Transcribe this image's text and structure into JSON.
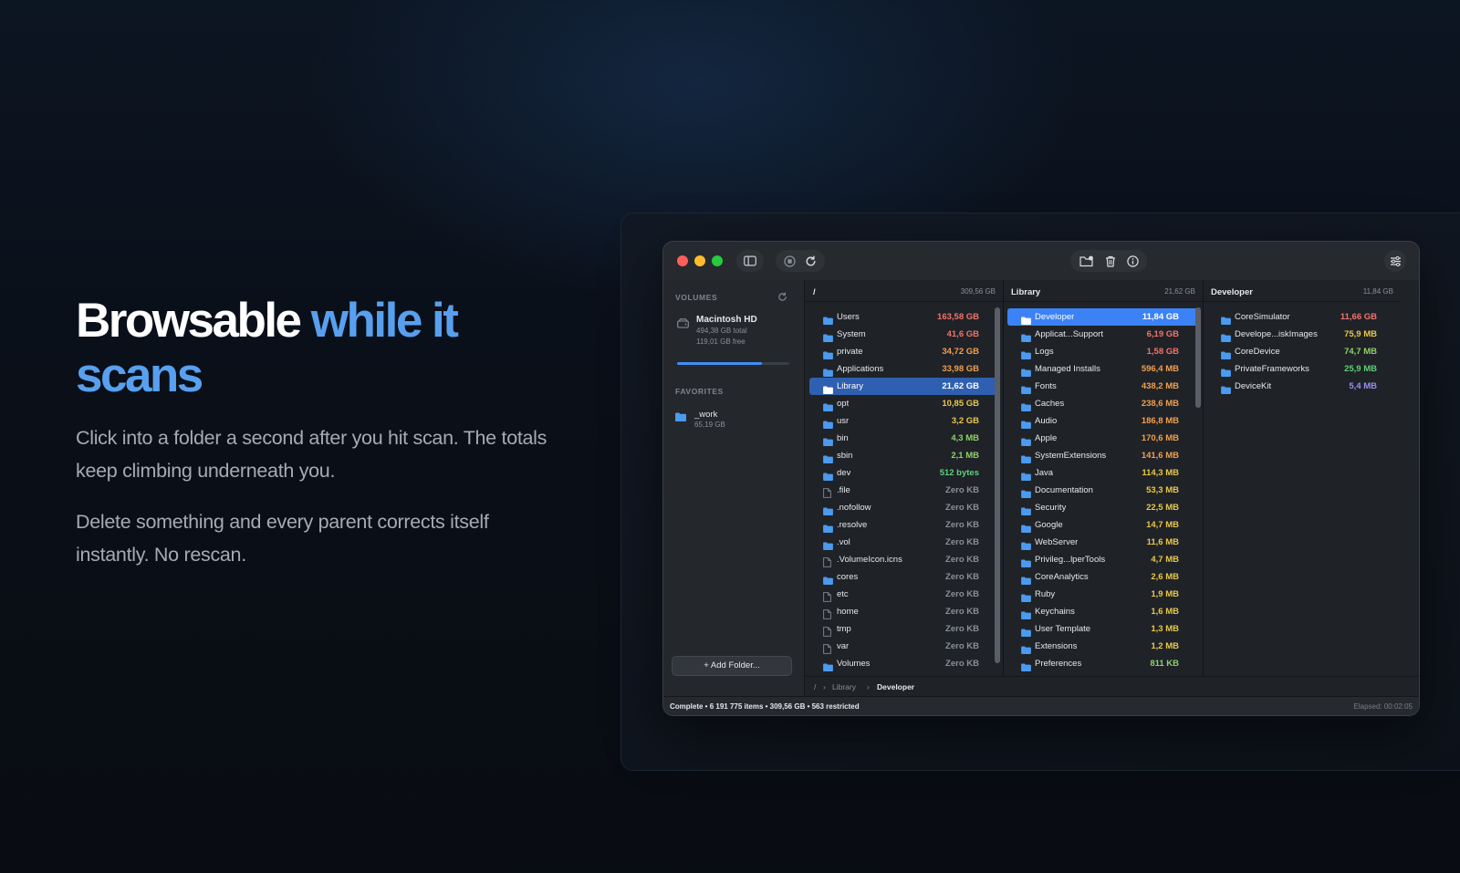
{
  "hero": {
    "title_plain": "Browsable ",
    "title_accent_1": "while it",
    "title_accent_2": "scans",
    "paragraph_1": "Click into a folder a second after you hit scan. The totals keep climbing underneath you.",
    "paragraph_2": "Delete something and every parent corrects itself instantly. No rescan."
  },
  "colors": {
    "accent": "#58a0ef",
    "selection_active": "#3b82f6",
    "selection_inactive": "#2f5fb0",
    "size_gb_large": "#f0746a",
    "size_gb_medium": "#f0a050",
    "size_gb": "#e8c84a",
    "size_mb": "#8fd16a",
    "size_small": "#5fd07a",
    "size_kb": "#9a8ff0"
  },
  "sidebar": {
    "volumes_label": "VOLUMES",
    "volume": {
      "name": "Macintosh HD",
      "total": "494,38 GB total",
      "free": "119,01 GB free",
      "used_fraction": 0.76
    },
    "favorites_label": "FAVORITES",
    "favorite": {
      "name": "_work",
      "size": "65,19 GB"
    },
    "add_folder_label": "+ Add Folder..."
  },
  "columns": [
    {
      "title": "/",
      "size": "309,56 GB",
      "rows": [
        {
          "name": "Users",
          "size": "163,58 GB",
          "kind": "folder",
          "color": "#f0746a"
        },
        {
          "name": "System",
          "size": "41,6 GB",
          "kind": "folder",
          "color": "#f0746a"
        },
        {
          "name": "private",
          "size": "34,72 GB",
          "kind": "folder",
          "color": "#f0a050"
        },
        {
          "name": "Applications",
          "size": "33,98 GB",
          "kind": "folder",
          "color": "#f0a050"
        },
        {
          "name": "Library",
          "size": "21,62 GB",
          "kind": "folder",
          "color": "#ffffff",
          "state": "selected"
        },
        {
          "name": "opt",
          "size": "10,85 GB",
          "kind": "folder",
          "color": "#e8c84a"
        },
        {
          "name": "usr",
          "size": "3,2 GB",
          "kind": "folder",
          "color": "#e8c84a"
        },
        {
          "name": "bin",
          "size": "4,3 MB",
          "kind": "folder",
          "color": "#8fd16a"
        },
        {
          "name": "sbin",
          "size": "2,1 MB",
          "kind": "folder",
          "color": "#8fd16a"
        },
        {
          "name": "dev",
          "size": "512 bytes",
          "kind": "folder",
          "color": "#5fd07a"
        },
        {
          "name": ".file",
          "size": "Zero KB",
          "kind": "file",
          "color": "#8b9098"
        },
        {
          "name": ".nofollow",
          "size": "Zero KB",
          "kind": "folder",
          "color": "#8b9098"
        },
        {
          "name": ".resolve",
          "size": "Zero KB",
          "kind": "folder",
          "color": "#8b9098"
        },
        {
          "name": ".vol",
          "size": "Zero KB",
          "kind": "folder",
          "color": "#8b9098"
        },
        {
          "name": ".VolumeIcon.icns",
          "size": "Zero KB",
          "kind": "file",
          "color": "#8b9098"
        },
        {
          "name": "cores",
          "size": "Zero KB",
          "kind": "folder",
          "color": "#8b9098"
        },
        {
          "name": "etc",
          "size": "Zero KB",
          "kind": "file",
          "color": "#8b9098"
        },
        {
          "name": "home",
          "size": "Zero KB",
          "kind": "file",
          "color": "#8b9098"
        },
        {
          "name": "tmp",
          "size": "Zero KB",
          "kind": "file",
          "color": "#8b9098"
        },
        {
          "name": "var",
          "size": "Zero KB",
          "kind": "file",
          "color": "#8b9098"
        },
        {
          "name": "Volumes",
          "size": "Zero KB",
          "kind": "folder",
          "color": "#8b9098"
        }
      ]
    },
    {
      "title": "Library",
      "size": "21,62 GB",
      "rows": [
        {
          "name": "Developer",
          "size": "11,84 GB",
          "kind": "folder",
          "color": "#ffffff",
          "state": "active"
        },
        {
          "name": "Applicat...Support",
          "size": "6,19 GB",
          "kind": "folder",
          "color": "#f0746a"
        },
        {
          "name": "Logs",
          "size": "1,58 GB",
          "kind": "folder",
          "color": "#f0746a"
        },
        {
          "name": "Managed Installs",
          "size": "596,4 MB",
          "kind": "folder",
          "color": "#f0a050"
        },
        {
          "name": "Fonts",
          "size": "438,2 MB",
          "kind": "folder",
          "color": "#f0a050"
        },
        {
          "name": "Caches",
          "size": "238,6 MB",
          "kind": "folder",
          "color": "#f0a050"
        },
        {
          "name": "Audio",
          "size": "186,8 MB",
          "kind": "folder",
          "color": "#f0a050"
        },
        {
          "name": "Apple",
          "size": "170,6 MB",
          "kind": "folder",
          "color": "#f0a050"
        },
        {
          "name": "SystemExtensions",
          "size": "141,6 MB",
          "kind": "folder",
          "color": "#f0a050"
        },
        {
          "name": "Java",
          "size": "114,3 MB",
          "kind": "folder",
          "color": "#e8c84a"
        },
        {
          "name": "Documentation",
          "size": "53,3 MB",
          "kind": "folder",
          "color": "#e8c84a"
        },
        {
          "name": "Security",
          "size": "22,5 MB",
          "kind": "folder",
          "color": "#e8c84a"
        },
        {
          "name": "Google",
          "size": "14,7 MB",
          "kind": "folder",
          "color": "#e8c84a"
        },
        {
          "name": "WebServer",
          "size": "11,6 MB",
          "kind": "folder",
          "color": "#e8c84a"
        },
        {
          "name": "Privileg...lperTools",
          "size": "4,7 MB",
          "kind": "folder",
          "color": "#e8c84a"
        },
        {
          "name": "CoreAnalytics",
          "size": "2,6 MB",
          "kind": "folder",
          "color": "#e8c84a"
        },
        {
          "name": "Ruby",
          "size": "1,9 MB",
          "kind": "folder",
          "color": "#e8c84a"
        },
        {
          "name": "Keychains",
          "size": "1,6 MB",
          "kind": "folder",
          "color": "#e8c84a"
        },
        {
          "name": "User Template",
          "size": "1,3 MB",
          "kind": "folder",
          "color": "#e8c84a"
        },
        {
          "name": "Extensions",
          "size": "1,2 MB",
          "kind": "folder",
          "color": "#e8c84a"
        },
        {
          "name": "Preferences",
          "size": "811 KB",
          "kind": "folder",
          "color": "#8fd16a"
        }
      ]
    },
    {
      "title": "Developer",
      "size": "11,84 GB",
      "rows": [
        {
          "name": "CoreSimulator",
          "size": "11,66 GB",
          "kind": "folder",
          "color": "#f0746a"
        },
        {
          "name": "Develope...iskImages",
          "size": "75,9 MB",
          "kind": "folder",
          "color": "#e8c84a"
        },
        {
          "name": "CoreDevice",
          "size": "74,7 MB",
          "kind": "folder",
          "color": "#8fd16a"
        },
        {
          "name": "PrivateFrameworks",
          "size": "25,9 MB",
          "kind": "folder",
          "color": "#5fd07a"
        },
        {
          "name": "DeviceKit",
          "size": "5,4 MB",
          "kind": "folder",
          "color": "#9a8ff0"
        }
      ]
    }
  ],
  "pathbar": {
    "root": "/",
    "seg1": "Library",
    "seg2": "Developer"
  },
  "statusbar": {
    "left": "Complete • 6 191 775 items • 309,56 GB • 563 restricted",
    "right": "Elapsed: 00:02:05"
  },
  "icons": [
    "sidebar-toggle-icon",
    "stop-icon",
    "refresh-icon",
    "new-folder-icon",
    "trash-icon",
    "info-icon",
    "settings-icon",
    "disk-icon",
    "folder-icon",
    "file-icon"
  ]
}
